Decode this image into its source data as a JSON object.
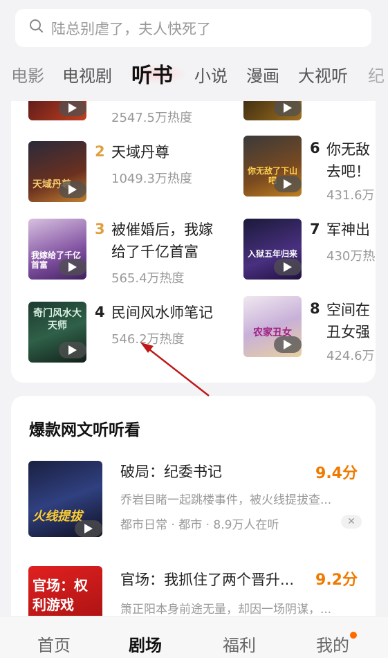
{
  "search": {
    "placeholder": "陆总别虐了，夫人快死了"
  },
  "categories": [
    "电影",
    "电视剧",
    "听书",
    "小说",
    "漫画",
    "大视听",
    "纪"
  ],
  "ranking": {
    "top_left_heat": "2547.5万热度",
    "left": [
      {
        "rank": "2",
        "title": "天域丹尊",
        "heat": "1049.3万热度",
        "cover_text": "天域丹尊"
      },
      {
        "rank": "3",
        "title_line1": "被催婚后，我嫁",
        "title_line2": "给了千亿首富",
        "heat": "565.4万热度",
        "cover_text": "我嫁给了千亿首富"
      },
      {
        "rank": "4",
        "title": "民间风水师笔记",
        "heat": "546.2万热度",
        "cover_text": "奇门风水大天师"
      }
    ],
    "right": [
      {
        "rank": "6",
        "title_line1": "你无敌",
        "title_line2": "去吧！",
        "heat": "431.6万",
        "cover_text": "你无敌了下山吧"
      },
      {
        "rank": "7",
        "title": "军神出",
        "heat": "430万热",
        "cover_text": "入狱五年归来"
      },
      {
        "rank": "8",
        "title_line1": "空间在",
        "title_line2": "丑女强",
        "heat": "424.6万",
        "cover_text": "农家丑女"
      }
    ]
  },
  "section": {
    "title": "爆款网文听听看",
    "books": [
      {
        "title": "破局：纪委书记",
        "score": "9.4分",
        "desc": "乔岩目睹一起跳楼事件，被火线提拔查...",
        "meta": "都市日常 · 都市 · 8.9万人在听",
        "cover_text": "火线提拔"
      },
      {
        "title": "官场：我抓住了两个晋升...",
        "score": "9.2分",
        "desc": "箫正阳本身前途无量，却因一场阴谋，...",
        "cover_text": "官场：权利游戏"
      }
    ]
  },
  "nav": [
    "首页",
    "剧场",
    "福利",
    "我的"
  ],
  "colors": {
    "accent": "#f07a00",
    "rank_gold": "#e0a040",
    "badge": "#ff6a00"
  }
}
